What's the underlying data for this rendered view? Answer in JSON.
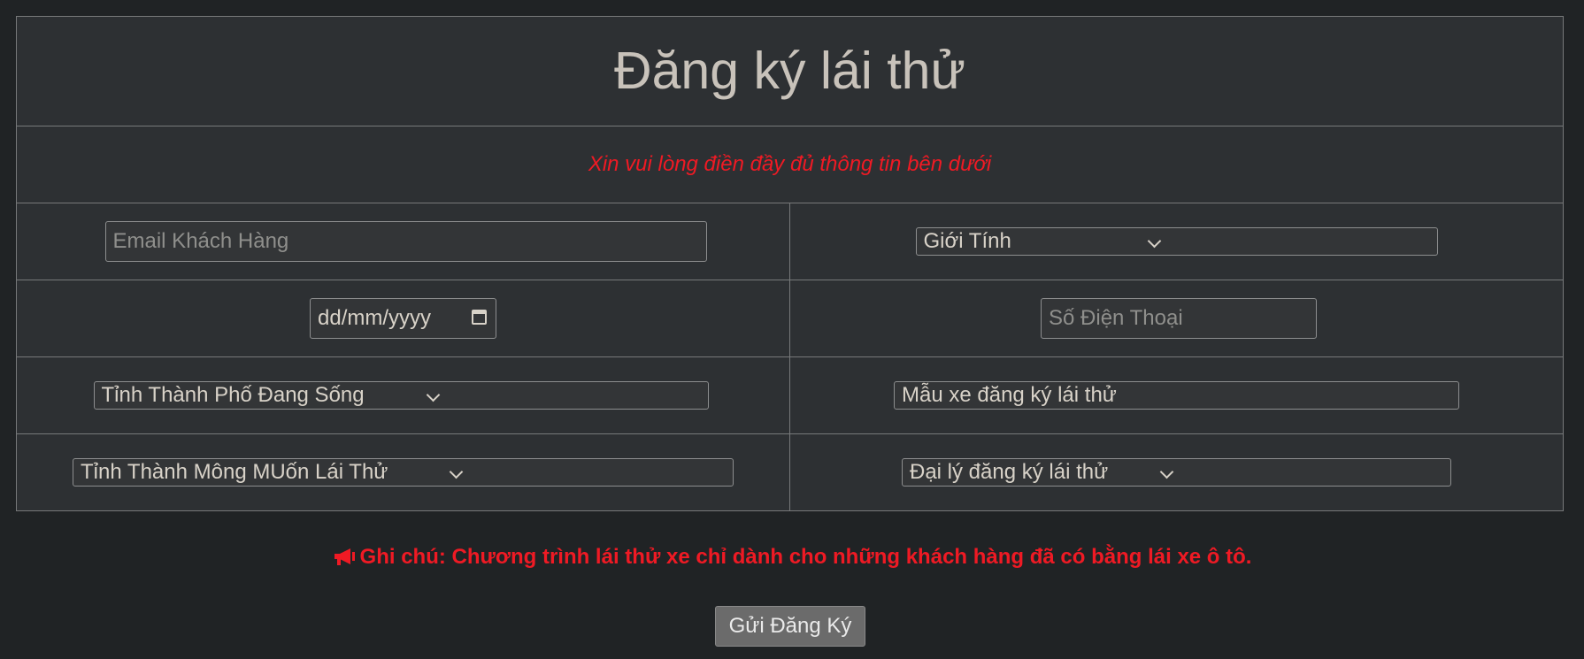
{
  "form": {
    "title": "Đăng ký lái thử",
    "subtitle": "Xin vui lòng điền đầy đủ thông tin bên dưới",
    "email_placeholder": "Email Khách Hàng",
    "gender_select": "Giới Tính",
    "date_placeholder": "dd/mm/yyyy",
    "phone_placeholder": "Số Điện Thoại",
    "province_living_select": "Tỉnh Thành Phố Đang Sống",
    "car_model_field": "Mẫu xe đăng ký lái thử",
    "province_test_drive_select": "Tỉnh Thành Mông MUốn Lái Thử",
    "dealer_select": "Đại lý đăng ký lái thử"
  },
  "note": {
    "icon": "megaphone-icon",
    "text": "Ghi chú: Chương trình lái thử xe chỉ dành cho những khách hàng đã có bằng lái xe ô tô."
  },
  "submit_label": "Gửi Đăng Ký",
  "colors": {
    "background": "#202325",
    "panel": "#2d3033",
    "accent_red": "#ef1a24",
    "button": "#6b6b6b"
  }
}
